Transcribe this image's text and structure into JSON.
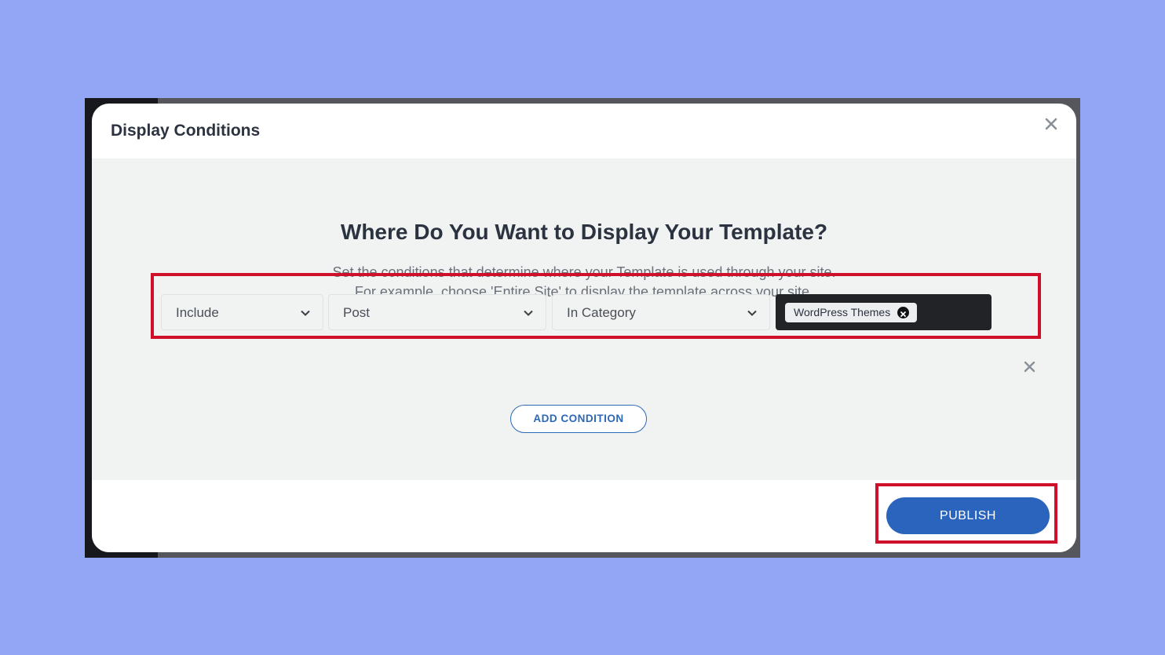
{
  "modal": {
    "title": "Display Conditions"
  },
  "body": {
    "heading": "Where Do You Want to Display Your Template?",
    "desc_line1": "Set the conditions that determine where your Template is used through your site.",
    "desc_line2": "For example, choose 'Entire Site' to display the template across your site."
  },
  "condition": {
    "type": "Include",
    "object": "Post",
    "sub": "In Category",
    "tags": [
      "WordPress Themes"
    ]
  },
  "actions": {
    "add_condition": "ADD CONDITION",
    "publish": "PUBLISH"
  },
  "colors": {
    "background": "#93a6f5",
    "highlight": "#d0102a",
    "accent": "#2a64bd"
  },
  "icons": {
    "close": "close-icon",
    "chevron": "chevron-down-icon",
    "tag_remove": "close-circle-icon",
    "row_remove": "close-icon"
  }
}
